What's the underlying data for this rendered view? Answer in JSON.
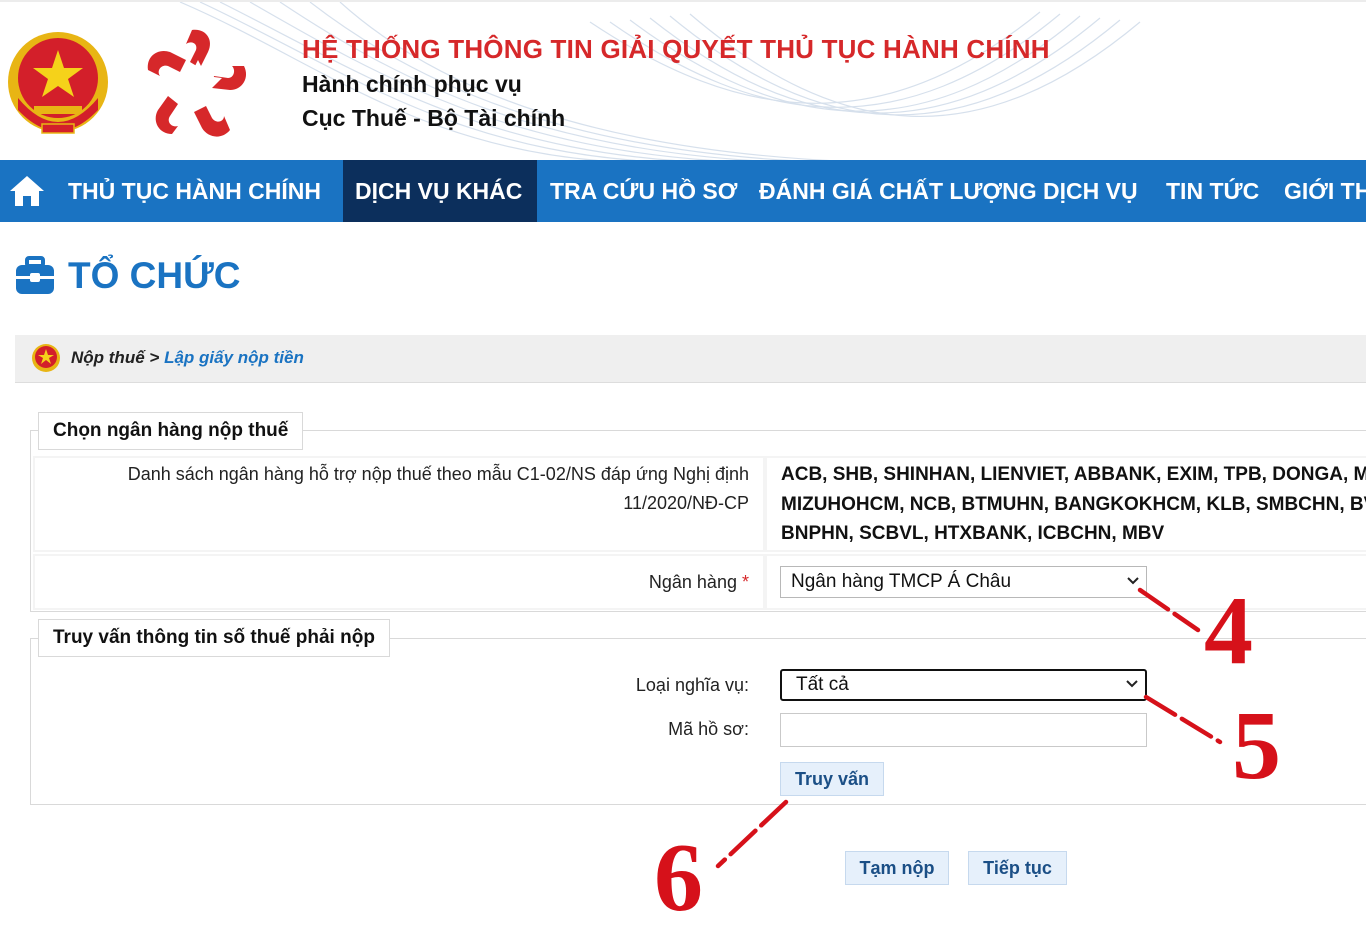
{
  "header": {
    "title": "HỆ THỐNG THÔNG TIN GIẢI QUYẾT THỦ TỤC HÀNH CHÍNH",
    "subtitle1": "Hành chính phục vụ",
    "subtitle2": "Cục Thuế - Bộ Tài chính",
    "emblem_icon": "national-emblem-icon",
    "logo_icon": "red-star-hands-logo"
  },
  "nav": {
    "home_icon": "home-icon",
    "items": [
      {
        "label": "THỦ TỤC HÀNH CHÍNH",
        "active": false
      },
      {
        "label": "DỊCH VỤ KHÁC",
        "active": true
      },
      {
        "label": "TRA CỨU HỒ SƠ",
        "active": false
      },
      {
        "label": "ĐÁNH GIÁ CHẤT LƯỢNG DỊCH VỤ",
        "active": false
      },
      {
        "label": "TIN TỨC",
        "active": false
      },
      {
        "label": "GIỚI THIỆU",
        "active": false
      }
    ]
  },
  "page": {
    "title": "TỔ CHỨC",
    "icon": "briefcase-icon"
  },
  "breadcrumb": {
    "icon": "emblem-small-icon",
    "parent": "Nộp thuế",
    "separator": ">",
    "current": "Lập giấy nộp tiền"
  },
  "bank_section": {
    "legend": "Chọn ngân hàng nộp thuế",
    "list_label_line1": "Danh sách ngân hàng hỗ trợ nộp thuế theo mẫu C1-02/NS đáp ứng Nghị định",
    "list_label_line2": "11/2020/NĐ-CP",
    "bank_list_line1": "ACB, SHB, SHINHAN, LIENVIET, ABBANK, EXIM, TPB, DONGA, MSB,",
    "bank_list_line2": "MIZUHOHCM, NCB, BTMUHN, BANGKOKHCM, KLB, SMBCHN, BVB,",
    "bank_list_line3": "BNPHN, SCBVL, HTXBANK, ICBCHN, MBV",
    "bank_label": "Ngân hàng",
    "required_mark": "*",
    "bank_selected": "Ngân hàng TMCP Á Châu"
  },
  "query_section": {
    "legend": "Truy vấn thông tin số thuế phải nộp",
    "obligation_label": "Loại nghĩa vụ:",
    "obligation_selected": "Tất cả",
    "record_label": "Mã hồ sơ:",
    "record_value": "",
    "query_button": "Truy vấn"
  },
  "actions": {
    "temp_submit": "Tạm nộp",
    "continue": "Tiếp tục"
  },
  "annotations": {
    "n4": "4",
    "n5": "5",
    "n6": "6",
    "color": "#d6111a"
  },
  "colors": {
    "nav_bg": "#1a73c2",
    "nav_active": "#0c2f5c",
    "title_red": "#d6282a",
    "link_blue": "#1a73c2"
  }
}
